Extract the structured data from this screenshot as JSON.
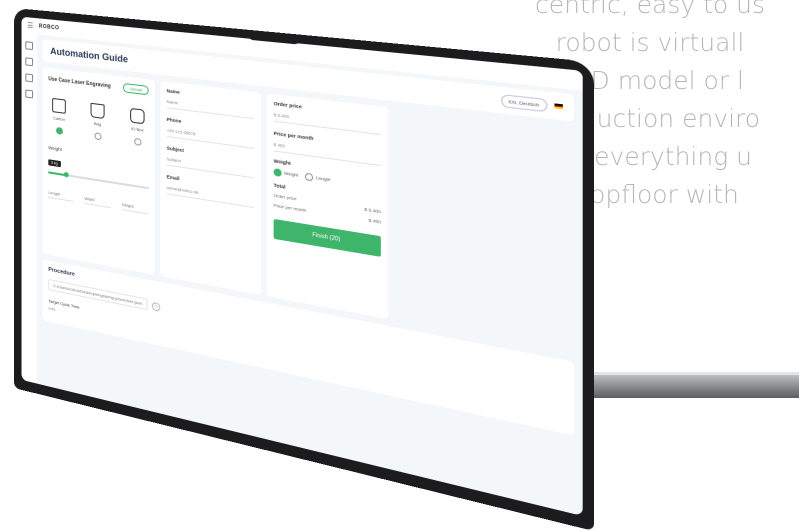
{
  "marketing": {
    "line1": "centric, easy to us",
    "line2": "robot is virtuall",
    "line3": "CAD model or l",
    "line4": "production enviro",
    "line5": "set everything u",
    "line6": "shopfloor with"
  },
  "app": {
    "logo": "ROBCO",
    "title": "Automation Guide",
    "language": "EN, Deutsch",
    "sidebar": [
      "home-icon",
      "box-icon",
      "settings-icon",
      "files-icon"
    ]
  },
  "use_case": {
    "title": "Use Case Laser Engraving",
    "action": "Upload",
    "items": [
      {
        "label": "Carton",
        "selected": true
      },
      {
        "label": "Bag",
        "selected": false
      },
      {
        "label": "IO Box",
        "selected": false
      }
    ],
    "weight_label": "Weight",
    "weight_value": "5 kg",
    "weight_fraction": 0.18,
    "dims": [
      "Length",
      "Width",
      "Height"
    ]
  },
  "contact": {
    "fields": [
      {
        "label": "Name",
        "value": "Name"
      },
      {
        "label": "Phone",
        "value": "+49 123 45678"
      },
      {
        "label": "Subject",
        "value": "Subject"
      },
      {
        "label": "Email",
        "value": "name@robco.de"
      }
    ]
  },
  "summary": {
    "fields": [
      {
        "label": "Order price",
        "value": "$ 5,400"
      },
      {
        "label": "Price per month",
        "value": "$ 450"
      }
    ],
    "weight_label": "Weight",
    "weight_options": [
      {
        "label": "Weight",
        "selected": true
      },
      {
        "label": "Length",
        "selected": false
      }
    ],
    "total_label": "Total",
    "rows": [
      {
        "name": "Order price",
        "value": "$ 5,400"
      },
      {
        "name": "Price per month",
        "value": "$ 450"
      }
    ],
    "cta": "Finish (20)"
  },
  "procedure": {
    "title": "Procedure",
    "path": "C:/Users/robco/Desktop/engraving-procedure.json",
    "help": "?",
    "sub": "Target Cycle Time",
    "sub2": "units"
  },
  "colors": {
    "accent": "#3fb56b",
    "copy_gray": "#b6b6b6",
    "laptop_body": "#1c1c1e"
  }
}
